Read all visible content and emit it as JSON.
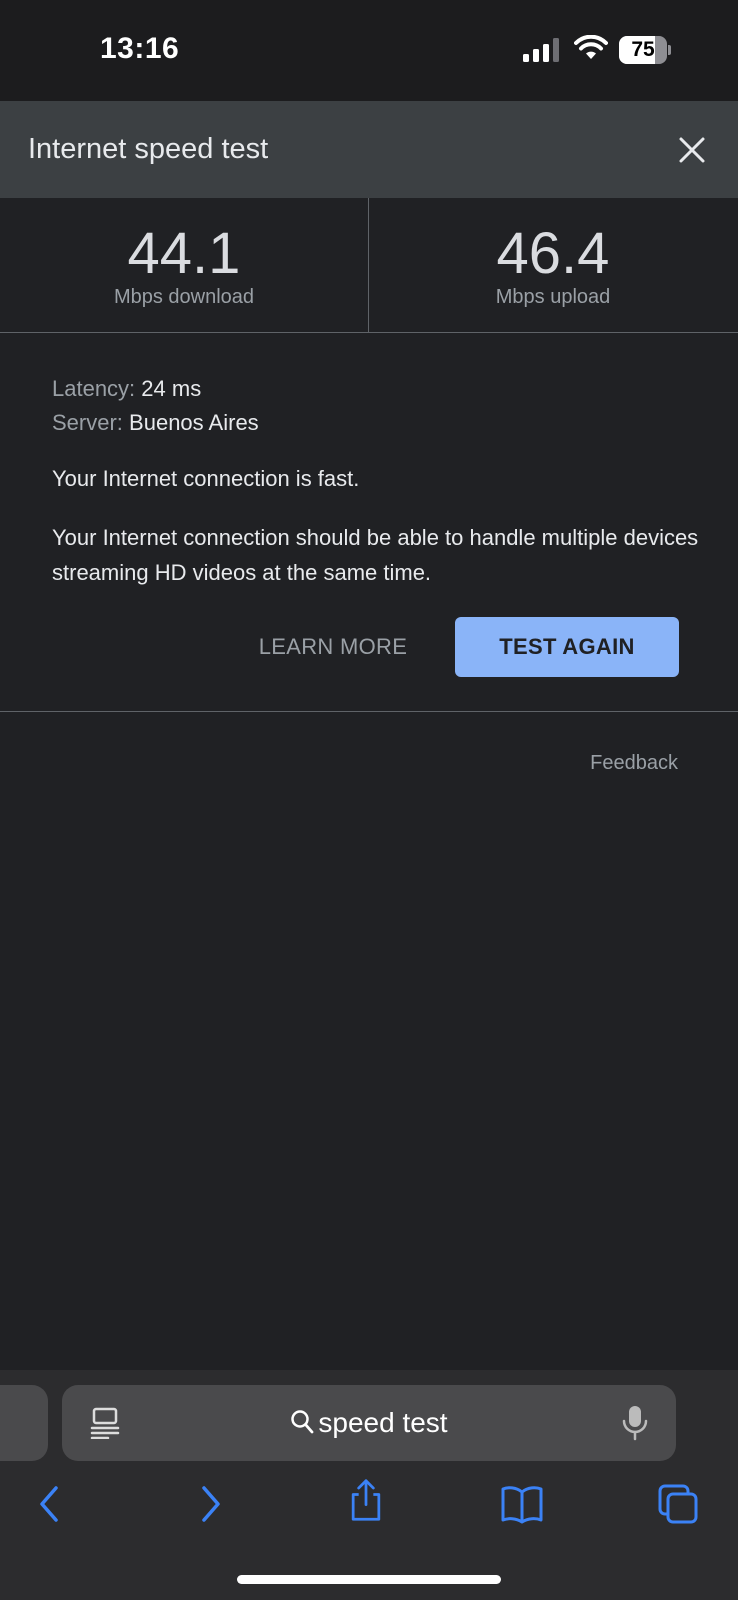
{
  "status_bar": {
    "time": "13:16",
    "battery_percent": "75",
    "battery_level": 0.75,
    "icons": [
      "signal-icon",
      "wifi-icon",
      "battery-icon"
    ]
  },
  "header": {
    "title": "Internet speed test",
    "close_icon": "close-icon"
  },
  "results": {
    "download": {
      "value": "44.1",
      "label": "Mbps download"
    },
    "upload": {
      "value": "46.4",
      "label": "Mbps upload"
    }
  },
  "info": {
    "latency_key": "Latency:",
    "latency_value": "24 ms",
    "server_key": "Server:",
    "server_value": "Buenos Aires",
    "summary": "Your Internet connection is fast.",
    "detail": "Your Internet connection should be able to handle multiple devices streaming HD videos at the same time."
  },
  "actions": {
    "learn_more": "LEARN MORE",
    "test_again": "TEST AGAIN"
  },
  "feedback": "Feedback",
  "browser": {
    "search_text": "speed test",
    "accent_color": "#3b82f6"
  },
  "colors": {
    "background": "#202124",
    "header": "#3c4043",
    "primary_button": "#8ab4f8"
  }
}
